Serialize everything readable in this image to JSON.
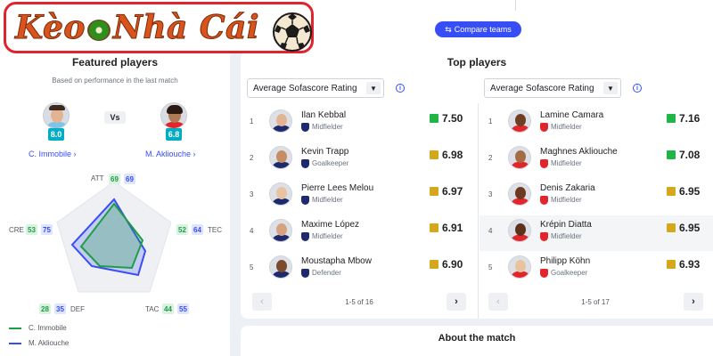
{
  "logo": {
    "word1": "Kèo",
    "word2": "Nhà Cái"
  },
  "compare_label": "Compare teams",
  "featured": {
    "title": "Featured players",
    "subtitle": "Based on performance in the last match",
    "vs": "Vs",
    "player1": {
      "name": "C. Immobile",
      "rating": "8.0",
      "color": "#1f9d45"
    },
    "player2": {
      "name": "M. Akliouche",
      "rating": "6.8",
      "color": "#374df5"
    },
    "radar": {
      "axes": [
        {
          "key": "ATT",
          "p1": "69",
          "p2": "69"
        },
        {
          "key": "TEC",
          "p1": "52",
          "p2": "64"
        },
        {
          "key": "TAC",
          "p1": "44",
          "p2": "55"
        },
        {
          "key": "DEF",
          "p1": "28",
          "p2": "35"
        },
        {
          "key": "CRE",
          "p1": "53",
          "p2": "75"
        }
      ]
    }
  },
  "top_players": {
    "title": "Top players",
    "left": {
      "dropdown": "Average Sofascore Rating",
      "pager": "1-5 of 16",
      "players": [
        {
          "rank": "1",
          "name": "Ilan Kebbal",
          "position": "Midfielder",
          "rating": "7.50",
          "rating_color": "#1fb547",
          "club_color": "#1e2a6e"
        },
        {
          "rank": "2",
          "name": "Kevin Trapp",
          "position": "Goalkeeper",
          "rating": "6.98",
          "rating_color": "#d4a81a",
          "club_color": "#1e2a6e"
        },
        {
          "rank": "3",
          "name": "Pierre Lees Melou",
          "position": "Midfielder",
          "rating": "6.97",
          "rating_color": "#d4a81a",
          "club_color": "#1e2a6e"
        },
        {
          "rank": "4",
          "name": "Maxime López",
          "position": "Midfielder",
          "rating": "6.91",
          "rating_color": "#d4a81a",
          "club_color": "#1e2a6e"
        },
        {
          "rank": "5",
          "name": "Moustapha Mbow",
          "position": "Defender",
          "rating": "6.90",
          "rating_color": "#d4a81a",
          "club_color": "#1e2a6e"
        }
      ]
    },
    "right": {
      "dropdown": "Average Sofascore Rating",
      "pager": "1-5 of 17",
      "players": [
        {
          "rank": "1",
          "name": "Lamine Camara",
          "position": "Midfielder",
          "rating": "7.16",
          "rating_color": "#1fb547",
          "club_color": "#e2252b"
        },
        {
          "rank": "2",
          "name": "Maghnes Akliouche",
          "position": "Midfielder",
          "rating": "7.08",
          "rating_color": "#1fb547",
          "club_color": "#e2252b"
        },
        {
          "rank": "3",
          "name": "Denis Zakaria",
          "position": "Midfielder",
          "rating": "6.95",
          "rating_color": "#d4a81a",
          "club_color": "#e2252b"
        },
        {
          "rank": "4",
          "name": "Krépin Diatta",
          "position": "Midfielder",
          "rating": "6.95",
          "rating_color": "#d4a81a",
          "club_color": "#e2252b"
        },
        {
          "rank": "5",
          "name": "Philipp Köhn",
          "position": "Goalkeeper",
          "rating": "6.93",
          "rating_color": "#d4a81a",
          "club_color": "#e2252b"
        }
      ]
    }
  },
  "about": {
    "title": "About the match"
  },
  "icons": {
    "caret": "caret-down-icon",
    "info": "info-icon",
    "prev": "chevron-left-icon",
    "next": "chevron-right-icon"
  }
}
